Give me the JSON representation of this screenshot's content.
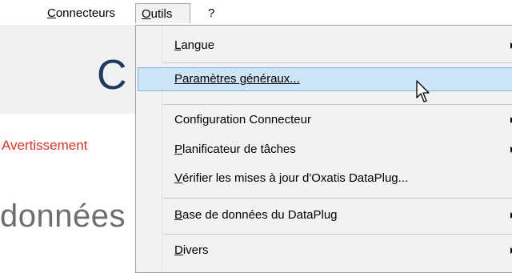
{
  "menubar": {
    "connecteurs_first": "C",
    "connecteurs_rest": "onnecteurs",
    "outils_first": "O",
    "outils_rest": "utils",
    "help": "?"
  },
  "background": {
    "big_letter": "C",
    "warning": "Avertissement",
    "donnees": "données"
  },
  "menu": {
    "items": [
      {
        "u": "L",
        "rest": "angue",
        "submenu": true
      },
      {
        "u": "P",
        "rest": "aramètres généraux...",
        "submenu": false,
        "highlighted": true
      },
      {
        "u": "",
        "rest": "Configuration Connecteur",
        "submenu": true
      },
      {
        "u": "P",
        "rest": "lanificateur de tâches",
        "submenu": true
      },
      {
        "u": "V",
        "rest": "érifier les mises à jour d'Oxatis DataPlug...",
        "submenu": false
      },
      {
        "u": "B",
        "rest": "ase de données du DataPlug",
        "submenu": true
      },
      {
        "u": "D",
        "rest": "ivers",
        "submenu": true
      }
    ]
  },
  "colors": {
    "highlight_bg": "#cde4f7",
    "highlight_border": "#82b5e6",
    "warning_text": "#d9342b",
    "title_text": "#1f3a5f"
  }
}
